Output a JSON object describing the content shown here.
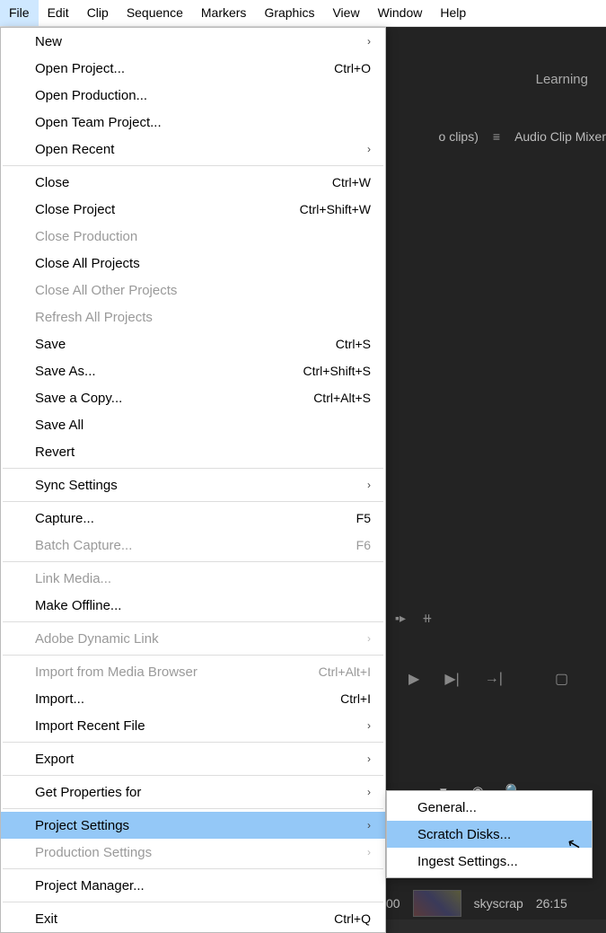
{
  "menubar": [
    "File",
    "Edit",
    "Clip",
    "Sequence",
    "Markers",
    "Graphics",
    "View",
    "Window",
    "Help"
  ],
  "active_menubar_index": 0,
  "workspace_tab": "Learning",
  "panel": {
    "clips": "o clips)",
    "mixer": "Audio Clip Mixer"
  },
  "file_menu": [
    {
      "type": "item",
      "label": "New",
      "shortcut": "",
      "arrow": true
    },
    {
      "type": "item",
      "label": "Open Project...",
      "shortcut": "Ctrl+O"
    },
    {
      "type": "item",
      "label": "Open Production..."
    },
    {
      "type": "item",
      "label": "Open Team Project..."
    },
    {
      "type": "item",
      "label": "Open Recent",
      "arrow": true
    },
    {
      "type": "sep"
    },
    {
      "type": "item",
      "label": "Close",
      "shortcut": "Ctrl+W"
    },
    {
      "type": "item",
      "label": "Close Project",
      "shortcut": "Ctrl+Shift+W"
    },
    {
      "type": "item",
      "label": "Close Production",
      "disabled": true
    },
    {
      "type": "item",
      "label": "Close All Projects"
    },
    {
      "type": "item",
      "label": "Close All Other Projects",
      "disabled": true
    },
    {
      "type": "item",
      "label": "Refresh All Projects",
      "disabled": true
    },
    {
      "type": "item",
      "label": "Save",
      "shortcut": "Ctrl+S"
    },
    {
      "type": "item",
      "label": "Save As...",
      "shortcut": "Ctrl+Shift+S"
    },
    {
      "type": "item",
      "label": "Save a Copy...",
      "shortcut": "Ctrl+Alt+S"
    },
    {
      "type": "item",
      "label": "Save All"
    },
    {
      "type": "item",
      "label": "Revert"
    },
    {
      "type": "sep"
    },
    {
      "type": "item",
      "label": "Sync Settings",
      "arrow": true
    },
    {
      "type": "sep"
    },
    {
      "type": "item",
      "label": "Capture...",
      "shortcut": "F5"
    },
    {
      "type": "item",
      "label": "Batch Capture...",
      "shortcut": "F6",
      "disabled": true
    },
    {
      "type": "sep"
    },
    {
      "type": "item",
      "label": "Link Media...",
      "disabled": true
    },
    {
      "type": "item",
      "label": "Make Offline..."
    },
    {
      "type": "sep"
    },
    {
      "type": "item",
      "label": "Adobe Dynamic Link",
      "arrow": true,
      "disabled": true
    },
    {
      "type": "sep"
    },
    {
      "type": "item",
      "label": "Import from Media Browser",
      "shortcut": "Ctrl+Alt+I",
      "disabled": true
    },
    {
      "type": "item",
      "label": "Import...",
      "shortcut": "Ctrl+I"
    },
    {
      "type": "item",
      "label": "Import Recent File",
      "arrow": true
    },
    {
      "type": "sep"
    },
    {
      "type": "item",
      "label": "Export",
      "arrow": true
    },
    {
      "type": "sep"
    },
    {
      "type": "item",
      "label": "Get Properties for",
      "arrow": true
    },
    {
      "type": "sep"
    },
    {
      "type": "item",
      "label": "Project Settings",
      "arrow": true,
      "highlight": true
    },
    {
      "type": "item",
      "label": "Production Settings",
      "arrow": true,
      "disabled": true
    },
    {
      "type": "sep"
    },
    {
      "type": "item",
      "label": "Project Manager..."
    },
    {
      "type": "sep"
    },
    {
      "type": "item",
      "label": "Exit",
      "shortcut": "Ctrl+Q"
    }
  ],
  "submenu": [
    {
      "label": "General..."
    },
    {
      "label": "Scratch Disks...",
      "highlight": true
    },
    {
      "label": "Ingest Settings..."
    }
  ],
  "thumb": {
    "name": "skyscrap",
    "time": "26:15",
    "counter": "00"
  }
}
